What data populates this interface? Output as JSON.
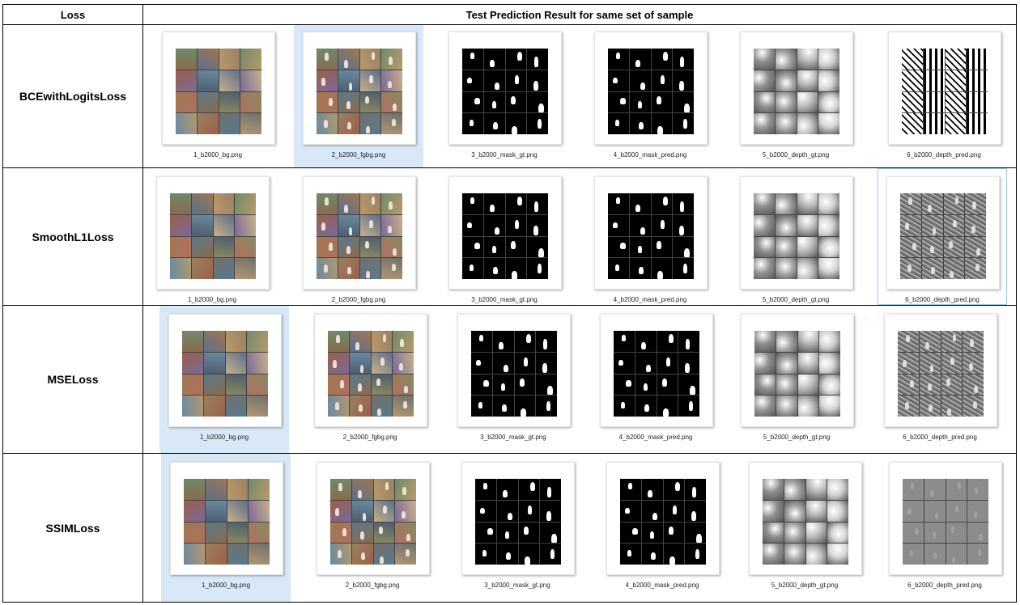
{
  "header": {
    "loss": "Loss",
    "result": "Test Prediction Result for same set of sample"
  },
  "rows": [
    {
      "loss": "BCEwithLogitsLoss",
      "files": [
        "1_b2000_bg.png",
        "2_b2000_fgbg.png",
        "3_b2000_mask_gt.png",
        "4_b2000_mask_pred.png",
        "5_b2000_depth_gt.png",
        "6_b2000_depth_pred.png"
      ],
      "selected_index": 1
    },
    {
      "loss": "SmoothL1Loss",
      "files": [
        "1_b2000_bg.png",
        "2_b2000_fgbg.png",
        "3_b2000_mask_gt.png",
        "4_b2000_mask_pred.png",
        "5_b2000_depth_gt.png",
        "6_b2000_depth_pred.png"
      ],
      "selected_index": 5
    },
    {
      "loss": "MSELoss",
      "files": [
        "1_b2000_bg.png",
        "2_b2000_fgbg.png",
        "3_b2000_mask_gt.png",
        "4_b2000_mask_pred.png",
        "5_b2000_depth_gt.png",
        "6_b2000_depth_pred.png"
      ],
      "selected_index": 0
    },
    {
      "loss": "SSIMLoss",
      "files": [
        "1_b2000_bg.png",
        "2_b2000_fgbg.png",
        "3_b2000_mask_gt.png",
        "4_b2000_mask_pred.png",
        "5_b2000_depth_gt.png",
        "6_b2000_depth_pred.png"
      ],
      "selected_index": 0
    }
  ],
  "colors": {
    "selection": "#d9e8f7",
    "selection_border": "#9ccbe8",
    "grid_line": "#000000"
  }
}
